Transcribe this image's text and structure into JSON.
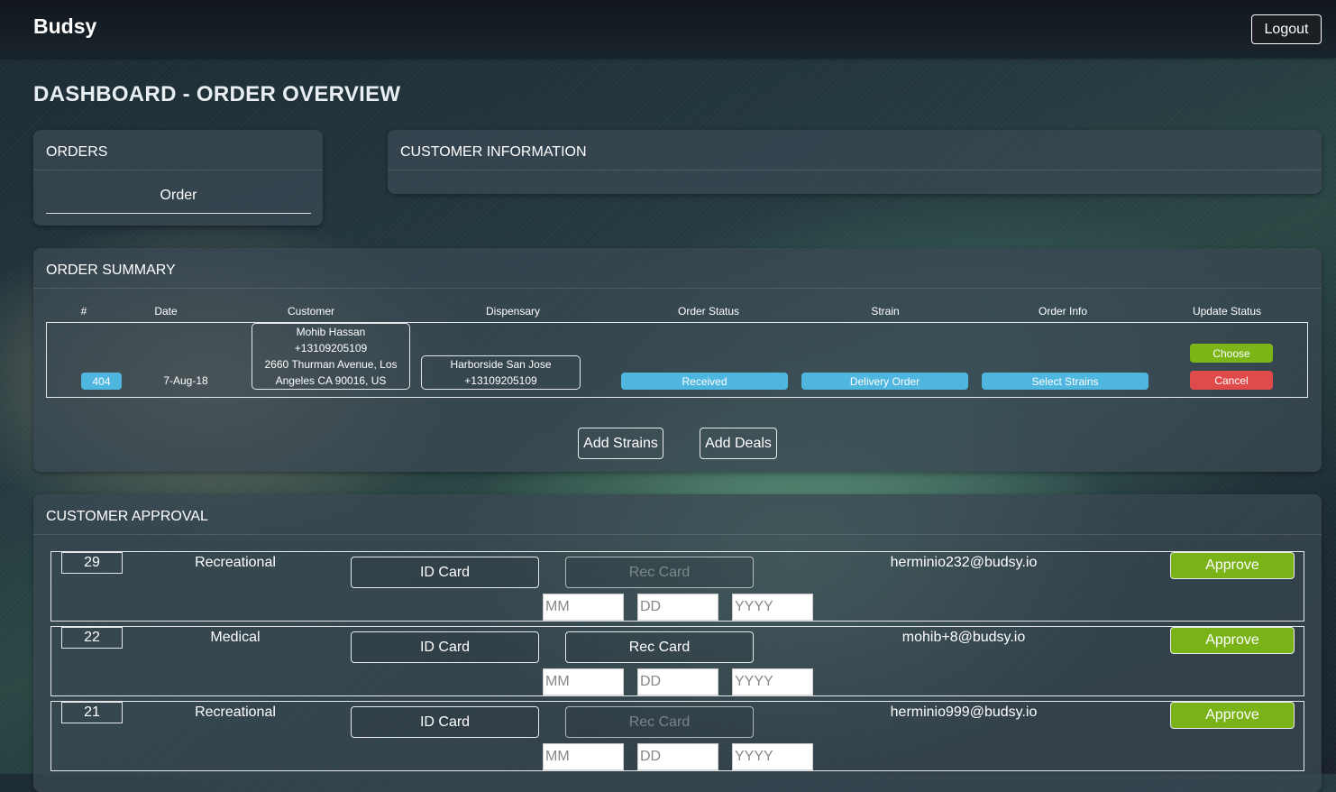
{
  "navbar": {
    "brand": "Budsy",
    "logout_label": "Logout"
  },
  "page_title": "DASHBOARD - ORDER OVERVIEW",
  "orders_panel": {
    "title": "ORDERS",
    "tab_label": "Order"
  },
  "customer_info_panel": {
    "title": "CUSTOMER INFORMATION"
  },
  "order_summary": {
    "title": "ORDER SUMMARY",
    "columns": [
      "#",
      "Date",
      "Customer",
      "Dispensary",
      "Order Status",
      "Strain",
      "Order Info",
      "Update Status"
    ],
    "row": {
      "id": "404",
      "date": "7-Aug-18",
      "customer_lines": [
        "Mohib Hassan",
        "+13109205109",
        "2660 Thurman Avenue, Los",
        "Angeles CA 90016, US"
      ],
      "dispensary_lines": [
        "Harborside San Jose",
        "+13109205109"
      ],
      "order_status": "Received",
      "strain": "Delivery Order",
      "order_info": "Select Strains",
      "choose_label": "Choose",
      "cancel_label": "Cancel"
    },
    "add_strains_label": "Add Strains",
    "add_deals_label": "Add Deals"
  },
  "customer_approval": {
    "title": "CUSTOMER APPROVAL",
    "rows": [
      {
        "id": "29",
        "type": "Recreational",
        "id_card_label": "ID Card",
        "rec_card_label": "Rec Card",
        "rec_card_enabled": false,
        "email": "herminio232@budsy.io",
        "approve_label": "Approve"
      },
      {
        "id": "22",
        "type": "Medical",
        "id_card_label": "ID Card",
        "rec_card_label": "Rec Card",
        "rec_card_enabled": true,
        "email": "mohib+8@budsy.io",
        "approve_label": "Approve"
      },
      {
        "id": "21",
        "type": "Recreational",
        "id_card_label": "ID Card",
        "rec_card_label": "Rec Card",
        "rec_card_enabled": false,
        "email": "herminio999@budsy.io",
        "approve_label": "Approve"
      }
    ],
    "date_placeholders": {
      "month": "MM",
      "day": "DD",
      "year": "YYYY"
    }
  },
  "colors": {
    "approve_green": "#7ab317",
    "cancel_red": "#e04a4a",
    "pill_blue": "#4fb6e0",
    "choose_green": "#7cb518"
  }
}
